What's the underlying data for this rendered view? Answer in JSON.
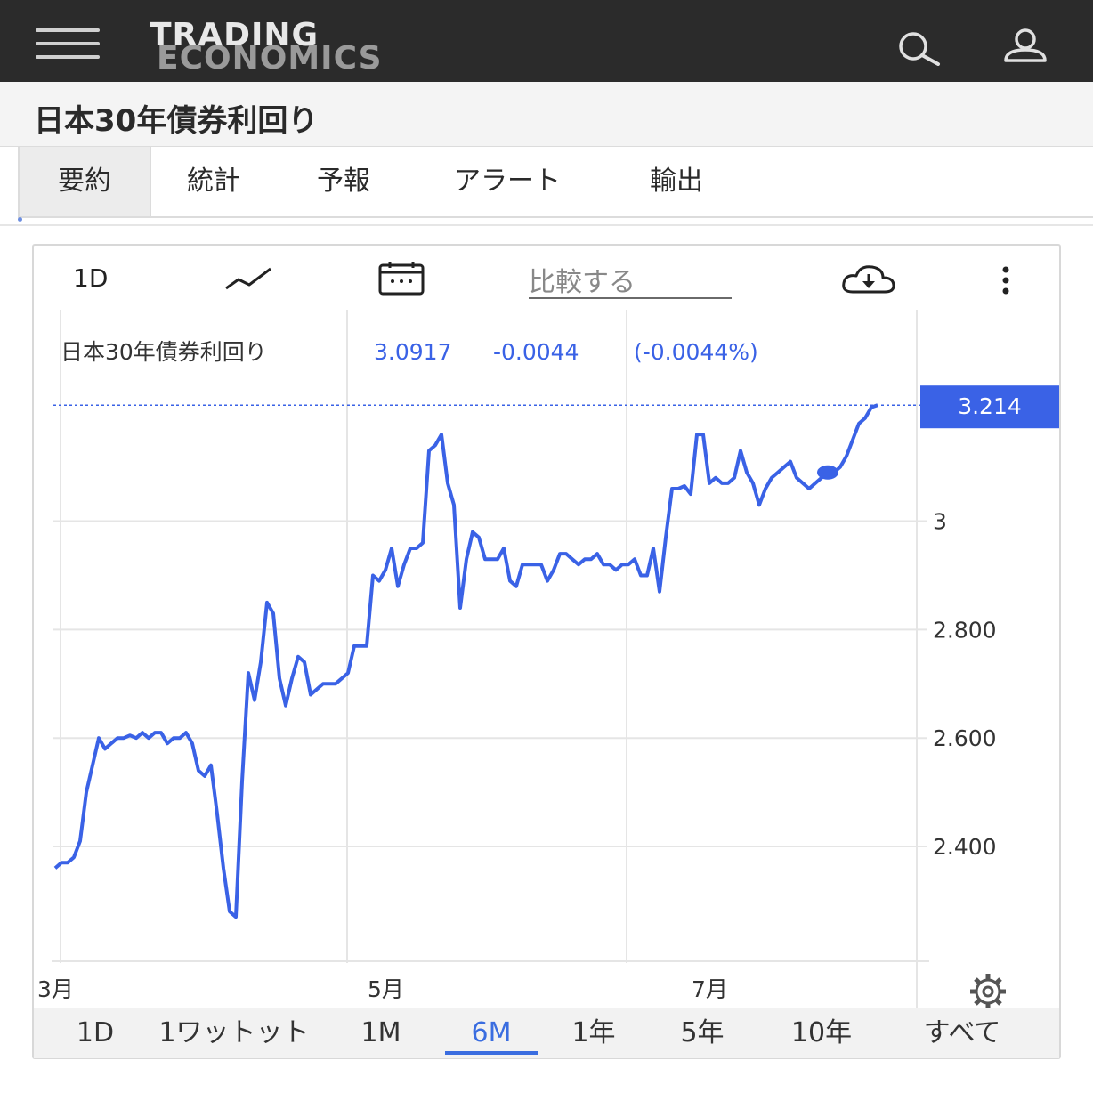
{
  "header": {
    "logo_line1": "TRADING",
    "logo_line2": "ECONOMICS",
    "menu_icon": "hamburger-menu-icon",
    "search_icon": "search-icon",
    "user_icon": "user-icon"
  },
  "page": {
    "title": "日本30年債券利回り"
  },
  "tabs": [
    {
      "label": "要約",
      "active": true
    },
    {
      "label": "統計",
      "active": false
    },
    {
      "label": "予報",
      "active": false
    },
    {
      "label": "アラート",
      "active": false
    },
    {
      "label": "輸出",
      "active": false
    }
  ],
  "toolbar": {
    "interval": "1D",
    "chart_type_icon": "line-chart-icon",
    "calendar_icon": "calendar-icon",
    "compare_placeholder": "比較する",
    "download_icon": "cloud-download-icon",
    "more_icon": "more-vertical-icon"
  },
  "legend": {
    "name": "日本30年債券利回り",
    "value": "3.0917",
    "change": "-0.0044",
    "change_pct": "(-0.0044%)"
  },
  "last_price_label": "3.214",
  "settings_icon": "gear-icon",
  "ranges": [
    {
      "label": "1D",
      "active": false
    },
    {
      "label": "1ワットット",
      "active": false
    },
    {
      "label": "1M",
      "active": false
    },
    {
      "label": "6M",
      "active": true
    },
    {
      "label": "1年",
      "active": false
    },
    {
      "label": "5年",
      "active": false
    },
    {
      "label": "10年",
      "active": false
    },
    {
      "label": "すべて",
      "active": false
    }
  ],
  "colors": {
    "line": "#3a62e6",
    "accent": "#3a6de0",
    "topbar": "#2b2b2b"
  },
  "chart_data": {
    "type": "line",
    "title": "日本30年債券利回り",
    "xlabel": "",
    "ylabel": "",
    "x_ticks": [
      "3月",
      "5月",
      "7月"
    ],
    "x_tick_index": [
      0,
      53,
      105
    ],
    "y_ticks": [
      "2.400",
      "2.600",
      "2.800",
      "3"
    ],
    "y_tick_values": [
      2.4,
      2.6,
      2.8,
      3.0
    ],
    "ylim": [
      2.185,
      3.39
    ],
    "last_value": 3.214,
    "grid": true,
    "series": [
      {
        "name": "日本30年債券利回り",
        "values": [
          2.36,
          2.37,
          2.37,
          2.38,
          2.41,
          2.5,
          2.55,
          2.6,
          2.58,
          2.59,
          2.6,
          2.6,
          2.605,
          2.6,
          2.61,
          2.6,
          2.61,
          2.61,
          2.59,
          2.6,
          2.6,
          2.61,
          2.59,
          2.54,
          2.53,
          2.55,
          2.46,
          2.36,
          2.28,
          2.27,
          2.52,
          2.72,
          2.67,
          2.74,
          2.85,
          2.83,
          2.71,
          2.66,
          2.71,
          2.75,
          2.74,
          2.68,
          2.69,
          2.7,
          2.7,
          2.7,
          2.71,
          2.72,
          2.77,
          2.77,
          2.77,
          2.9,
          2.89,
          2.91,
          2.95,
          2.88,
          2.92,
          2.95,
          2.95,
          2.96,
          3.13,
          3.14,
          3.16,
          3.07,
          3.03,
          2.84,
          2.93,
          2.98,
          2.97,
          2.93,
          2.93,
          2.93,
          2.95,
          2.89,
          2.88,
          2.92,
          2.92,
          2.92,
          2.92,
          2.89,
          2.91,
          2.94,
          2.94,
          2.93,
          2.92,
          2.93,
          2.93,
          2.94,
          2.92,
          2.92,
          2.91,
          2.92,
          2.92,
          2.93,
          2.9,
          2.9,
          2.95,
          2.87,
          2.97,
          3.06,
          3.06,
          3.065,
          3.05,
          3.16,
          3.16,
          3.07,
          3.08,
          3.07,
          3.07,
          3.08,
          3.13,
          3.09,
          3.07,
          3.03,
          3.06,
          3.08,
          3.09,
          3.1,
          3.11,
          3.08,
          3.07,
          3.06,
          3.07,
          3.08,
          3.09,
          3.09,
          3.1,
          3.12,
          3.15,
          3.18,
          3.19,
          3.21,
          3.214
        ]
      }
    ]
  }
}
